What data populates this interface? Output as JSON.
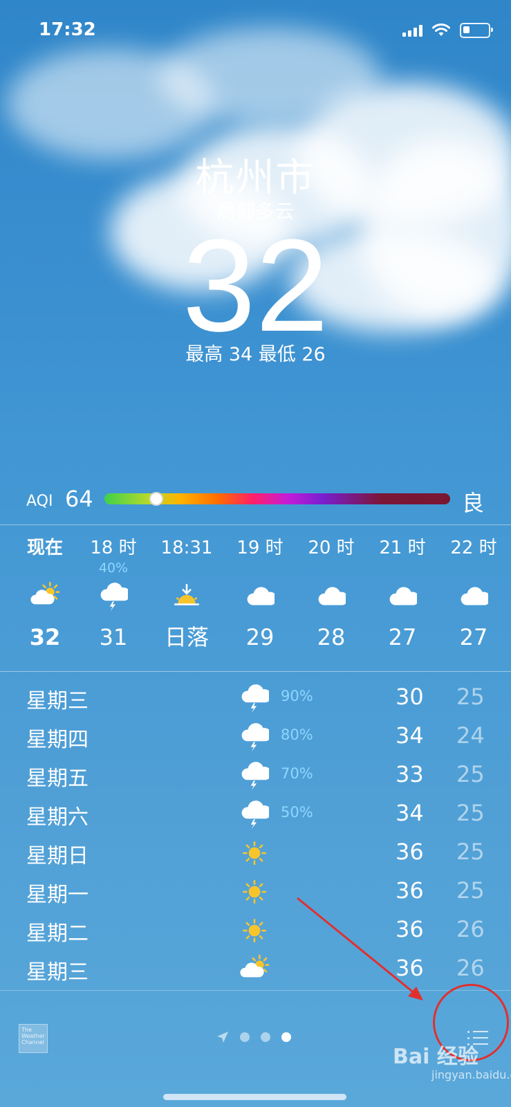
{
  "status_bar": {
    "time": "17:32"
  },
  "location": {
    "city": "杭州市",
    "condition": "局部多云"
  },
  "current": {
    "temperature": "32",
    "high_low": "最高 34  最低 26"
  },
  "aqi": {
    "label": "AQI",
    "value": "64",
    "grade": "良",
    "level_fraction": 0.15
  },
  "hourly": [
    {
      "time": "现在",
      "precip": "",
      "icon": "partly-sunny-icon",
      "temp": "32"
    },
    {
      "time": "18 时",
      "precip": "40%",
      "icon": "thunderstorm-icon",
      "temp": "31"
    },
    {
      "time": "18:31",
      "precip": "",
      "icon": "sunset-icon",
      "temp": "日落"
    },
    {
      "time": "19 时",
      "precip": "",
      "icon": "cloud-icon",
      "temp": "29"
    },
    {
      "time": "20 时",
      "precip": "",
      "icon": "cloud-icon",
      "temp": "28"
    },
    {
      "time": "21 时",
      "precip": "",
      "icon": "cloud-icon",
      "temp": "27"
    },
    {
      "time": "22 时",
      "precip": "",
      "icon": "cloud-icon",
      "temp": "27"
    }
  ],
  "daily": [
    {
      "day": "星期三",
      "icon": "thunderstorm-icon",
      "precip": "90%",
      "high": "30",
      "low": "25"
    },
    {
      "day": "星期四",
      "icon": "thunderstorm-icon",
      "precip": "80%",
      "high": "34",
      "low": "24"
    },
    {
      "day": "星期五",
      "icon": "thunderstorm-icon",
      "precip": "70%",
      "high": "33",
      "low": "25"
    },
    {
      "day": "星期六",
      "icon": "thunderstorm-icon",
      "precip": "50%",
      "high": "34",
      "low": "25"
    },
    {
      "day": "星期日",
      "icon": "sun-icon",
      "precip": "",
      "high": "36",
      "low": "25"
    },
    {
      "day": "星期一",
      "icon": "sun-icon",
      "precip": "",
      "high": "36",
      "low": "25"
    },
    {
      "day": "星期二",
      "icon": "sun-icon",
      "precip": "",
      "high": "36",
      "low": "26"
    },
    {
      "day": "星期三",
      "icon": "partly-sunny-icon",
      "precip": "",
      "high": "36",
      "low": "26"
    }
  ],
  "footer": {
    "logo_text": "The Weather Channel"
  },
  "watermark": {
    "brand": "Bai 经验",
    "url": "jingyan.baidu.com"
  },
  "colors": {
    "precip": "#8fd6ff",
    "sun": "#f7c52b",
    "annotation": "#e0302e"
  }
}
